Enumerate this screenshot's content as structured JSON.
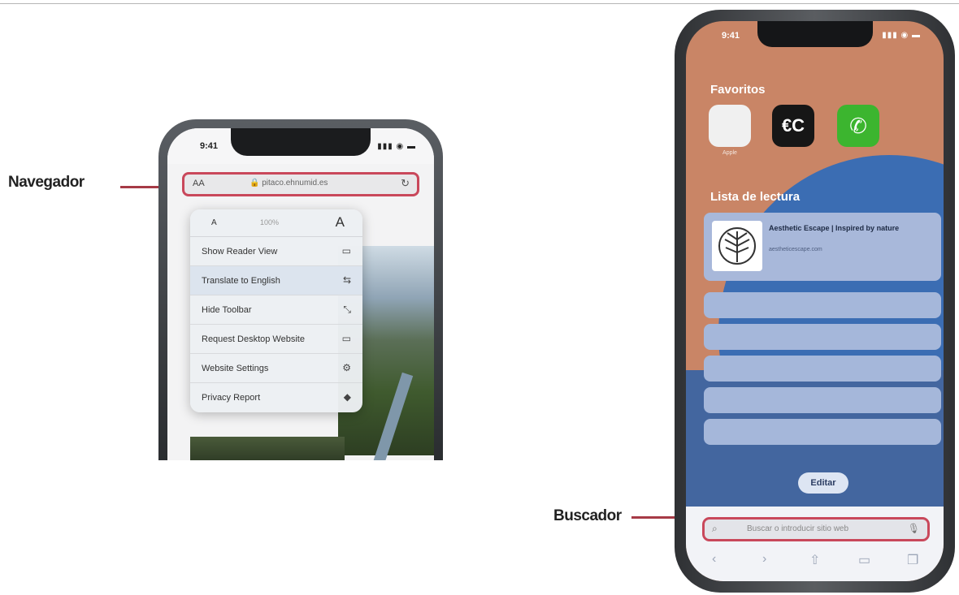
{
  "callouts": {
    "navegador": "Navegador",
    "buscador": "Buscador"
  },
  "colors": {
    "highlight": "#c9485b",
    "arrow": "#a63a46",
    "wallpaper": "#c98566",
    "accent_blue": "#3b6db3"
  },
  "phone_small": {
    "time": "9:41",
    "address_bar": {
      "left_label": "AA",
      "url": "🔒 pitaco.ehnumid.es",
      "reload_icon": "reload-icon"
    },
    "text_size_menu": {
      "small_a": "A",
      "percent": "100%",
      "large_a": "A"
    },
    "menu_items": [
      {
        "label": "Show Reader View",
        "icon": "reader-icon",
        "glyph": "▭"
      },
      {
        "label": "Translate to English",
        "icon": "translate-icon",
        "glyph": "⇆"
      },
      {
        "label": "Hide Toolbar",
        "icon": "resize-icon",
        "glyph": "⤡"
      },
      {
        "label": "Request Desktop Website",
        "icon": "desktop-icon",
        "glyph": "▭"
      },
      {
        "label": "Website Settings",
        "icon": "gear-icon",
        "glyph": "⚙"
      },
      {
        "label": "Privacy Report",
        "icon": "shield-icon",
        "glyph": "◆"
      }
    ]
  },
  "phone_large": {
    "time": "9:41",
    "favorites_title": "Favoritos",
    "favorites": [
      {
        "name": "apple-favorite",
        "glyph": ""
      },
      {
        "name": "ec-favorite",
        "glyph": "€C"
      },
      {
        "name": "whatsapp-favorite",
        "glyph": "✆"
      }
    ],
    "favorite_caption": "Apple",
    "reading_list_title": "Lista de lectura",
    "reading_card": {
      "title": "Aesthetic Escape | Inspired by nature",
      "subtitle": "aestheticescape.com"
    },
    "edit_button": "Editar",
    "search": {
      "placeholder": "Buscar o introducir sitio web"
    },
    "toolbar": [
      "back-icon",
      "forward-icon",
      "share-icon",
      "bookmarks-icon",
      "tabs-icon"
    ]
  }
}
